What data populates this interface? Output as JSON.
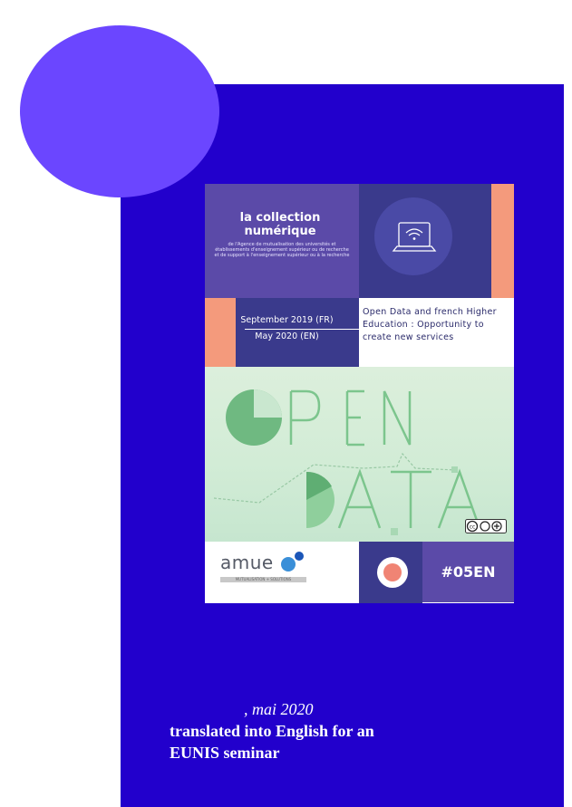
{
  "cover": {
    "collection_title": "la collection numérique",
    "collection_subtitle": "de l'Agence de mutualisation des universités et établissements d'enseignement supérieur ou de recherche et de support à l'enseignement supérieur ou à la recherche",
    "date_fr": "September 2019 (FR)",
    "date_en": "May 2020 (EN)",
    "headline": "Open Data and french Higher Education : Opportunity to create new services",
    "art_word_1": "OPEN",
    "art_word_2": "DATA",
    "logo_text": "amue",
    "logo_tagline": "MUTUALISATION + SOLUTIONS",
    "issue_tag": "#05EN",
    "license_icon": "creative-commons-icon"
  },
  "caption": {
    "date": ", mai 2020",
    "description": "translated into English for an EUNIS seminar"
  },
  "colors": {
    "panel": "#2200cc",
    "circle": "#6b46ff",
    "cover_purple": "#5b4aa8",
    "cover_navy": "#3a3a8c",
    "coral": "#f49a7c"
  }
}
